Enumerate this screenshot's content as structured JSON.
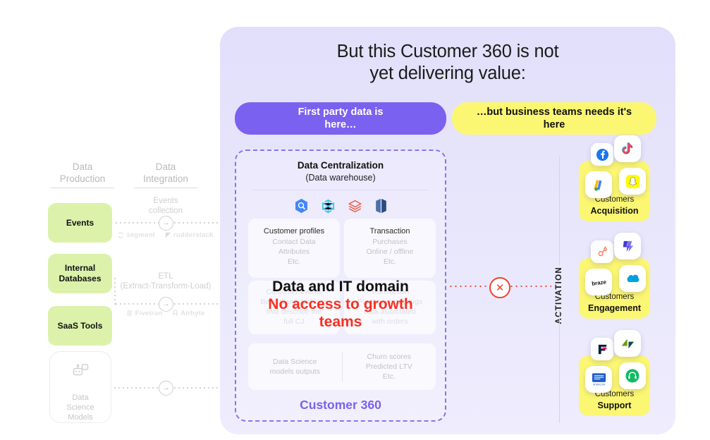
{
  "panel": {
    "title": "But this Customer 360 is not\nyet delivering value:",
    "pill_left": "First party data is\nhere…",
    "pill_right": "…but business teams needs it's\nhere"
  },
  "left": {
    "columns": [
      {
        "title": "Data\nProduction"
      },
      {
        "title": "Data\nIntegration"
      }
    ],
    "sources": [
      {
        "label": "Events"
      },
      {
        "label": "Internal\nDatabases"
      },
      {
        "label": "SaaS Tools"
      }
    ],
    "ds_models": {
      "label": "Data\nScience\nModels",
      "icon": "robot-icon"
    },
    "integrations": [
      {
        "label": "Events\ncollection",
        "vendors": [
          {
            "name": "segment",
            "icon": "segment-icon"
          },
          {
            "name": "rudderstack",
            "icon": "rudderstack-icon"
          }
        ]
      },
      {
        "label": "ETL\n(Extract-Transform-Load)",
        "vendors": [
          {
            "name": "Fivetran",
            "icon": "fivetran-icon"
          },
          {
            "name": "Airbyte",
            "icon": "airbyte-icon"
          }
        ]
      }
    ],
    "arrow_glyph": "→"
  },
  "center": {
    "title": "Data Centralization",
    "subtitle": "(Data warehouse)",
    "warehouse_icons": [
      {
        "name": "bigquery-icon"
      },
      {
        "name": "snowflake-icon"
      },
      {
        "name": "databricks-icon"
      },
      {
        "name": "redshift-icon"
      }
    ],
    "cards_top": [
      {
        "head": "Customer profiles",
        "body": "Contact Data\nAttributes\nEtc."
      },
      {
        "head": "Transaction",
        "body": "Purchases\nOnline / offline\nEtc."
      }
    ],
    "cards_mid": [
      {
        "head": "Customer events",
        "body": "Behaviours and logs\nthat describe the\nfull CJ"
      },
      {
        "head": "Transaction",
        "body": "Purchases and logs\ndata associated\nwith orders"
      }
    ],
    "cards_bottom": [
      {
        "body": "Data Science\nmodels outputs"
      },
      {
        "body": "Churn scores\nPredicted LTV\nEtc."
      }
    ],
    "overlay_black": "Data and IT domain",
    "overlay_red": "No access to growth\nteams",
    "footer_label": "Customer 360"
  },
  "activation": {
    "axis_label": "ACTIVATION",
    "block_icon": "x-circle-icon",
    "block_glyph": "✕",
    "blocks": [
      {
        "line1": "Customers",
        "line2": "Acquisition",
        "logos": [
          {
            "name": "facebook-icon"
          },
          {
            "name": "tiktok-icon"
          },
          {
            "name": "google-ads-icon"
          },
          {
            "name": "snapchat-icon"
          }
        ]
      },
      {
        "line1": "Customers",
        "line2": "Engagement",
        "logos": [
          {
            "name": "hubspot-icon"
          },
          {
            "name": "iterable-icon"
          },
          {
            "name": "braze-icon"
          },
          {
            "name": "salesforce-icon"
          }
        ]
      },
      {
        "line1": "Customers",
        "line2": "Support",
        "logos": [
          {
            "name": "front-icon"
          },
          {
            "name": "zendesk-icon"
          },
          {
            "name": "intercom-icon"
          },
          {
            "name": "helpdesk-icon"
          }
        ]
      }
    ]
  },
  "colors": {
    "purple": "#7b61ef",
    "yellow": "#fcf773",
    "green": "#dcf2ab",
    "red": "#fb2e1f",
    "panel_bg": "#e6e3fb"
  }
}
